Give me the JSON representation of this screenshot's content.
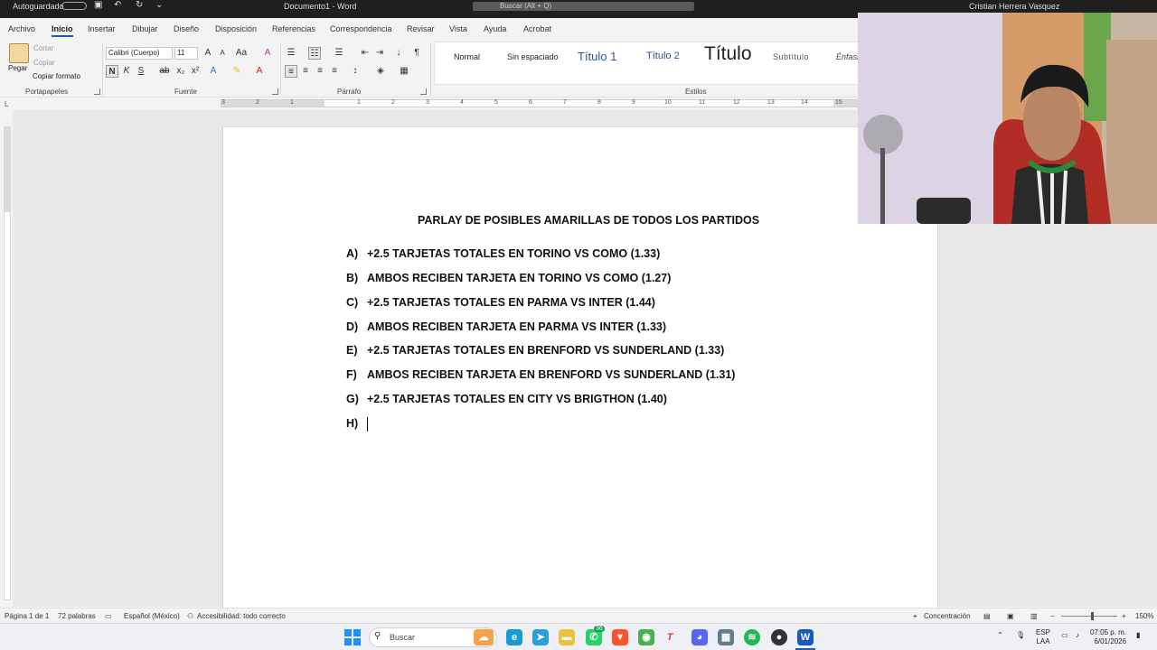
{
  "titlebar": {
    "autosave": "Autoguardado",
    "doc_title": "Documento1 - Word",
    "search_placeholder": "Buscar (Alt + Q)",
    "user": "Cristian Herrera Vasquez"
  },
  "tabs": [
    "Archivo",
    "Inicio",
    "Insertar",
    "Dibujar",
    "Diseño",
    "Disposición",
    "Referencias",
    "Correspondencia",
    "Revisar",
    "Vista",
    "Ayuda",
    "Acrobat"
  ],
  "ribbon": {
    "clipboard": {
      "paste": "Pegar",
      "cut": "Cortar",
      "copy": "Copiar",
      "format_painter": "Copiar formato",
      "label": "Portapapeles"
    },
    "font": {
      "family": "Calibri (Cuerpo)",
      "size": "11",
      "label": "Fuente"
    },
    "paragraph": {
      "label": "Párrafo"
    },
    "styles": {
      "items": [
        "Normal",
        "Sin espaciado",
        "Título 1",
        "Título 2",
        "Título",
        "Subtítulo",
        "Énfasis"
      ],
      "label": "Estilos"
    }
  },
  "ruler_numbers": [
    "3",
    "2",
    "1",
    "1",
    "2",
    "3",
    "4",
    "5",
    "6",
    "7",
    "8",
    "9",
    "10",
    "11",
    "12",
    "13",
    "14",
    "15"
  ],
  "document": {
    "heading": "PARLAY DE POSIBLES AMARILLAS DE TODOS LOS PARTIDOS",
    "items": [
      {
        "letter": "A)",
        "text": "+2.5 TARJETAS TOTALES EN TORINO VS COMO (1.33)"
      },
      {
        "letter": "B)",
        "text": "AMBOS RECIBEN TARJETA EN TORINO VS COMO (1.27)"
      },
      {
        "letter": "C)",
        "text": "+2.5 TARJETAS TOTALES EN PARMA VS INTER (1.44)"
      },
      {
        "letter": "D)",
        "text": "AMBOS RECIBEN TARJETA EN PARMA VS INTER (1.33)"
      },
      {
        "letter": "E)",
        "text": "+2.5 TARJETAS TOTALES EN BRENFORD VS SUNDERLAND (1.33)"
      },
      {
        "letter": "F)",
        "text": "AMBOS RECIBEN TARJETA EN BRENFORD VS SUNDERLAND (1.31)"
      },
      {
        "letter": "G)",
        "text": "+2.5 TARJETAS TOTALES EN CITY VS BRIGTHON (1.40)"
      },
      {
        "letter": "H)",
        "text": ""
      }
    ]
  },
  "statusbar": {
    "page": "Página 1 de 1",
    "words": "72 palabras",
    "language": "Español (México)",
    "accessibility": "Accesibilidad: todo correcto",
    "focus": "Concentración",
    "zoom": "150%"
  },
  "taskbar": {
    "search_placeholder": "Buscar",
    "lang_top": "ESP",
    "lang_bottom": "LAA",
    "time": "07:05 p. m.",
    "date": "6/01/2026",
    "whatsapp_badge": "36"
  }
}
